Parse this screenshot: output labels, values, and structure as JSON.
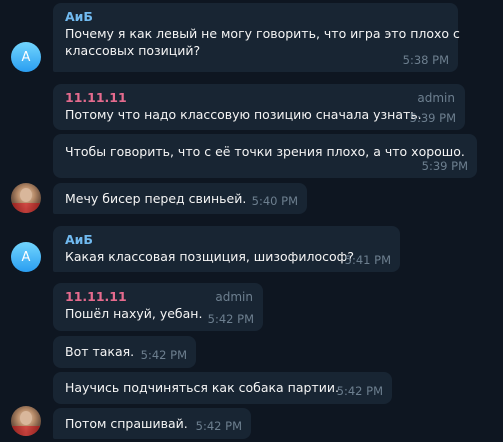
{
  "messages": [
    {
      "sender": "АиБ",
      "lines": [
        "Почему я как левый не могу говорить, что игра это плохо с",
        "классовых позиций?"
      ],
      "time": "5:38 PM"
    },
    {
      "sender": "11.11.11",
      "badge": "admin",
      "lines": [
        "Потому что надо классовую позицию сначала узнать."
      ],
      "time": "5:39 PM"
    },
    {
      "lines": [
        "Чтобы говорить, что с её точки зрения плохо, а что хорошо."
      ],
      "time": "5:39 PM"
    },
    {
      "lines": [
        "Мечу бисер перед свиньей."
      ],
      "time": "5:40 PM"
    },
    {
      "sender": "АиБ",
      "lines": [
        "Какая классовая позщиция, шизофилософ?"
      ],
      "time": "5:41 PM"
    },
    {
      "sender": "11.11.11",
      "badge": "admin",
      "lines": [
        "Пошёл нахуй, уебан."
      ],
      "time": "5:42 PM"
    },
    {
      "lines": [
        "Вот такая."
      ],
      "time": "5:42 PM"
    },
    {
      "lines": [
        "Научись подчиняться как собака партии."
      ],
      "time": "5:42 PM"
    },
    {
      "lines": [
        "Потом спрашивай."
      ],
      "time": "5:42 PM"
    }
  ],
  "avatars": {
    "aib_letter": "A"
  },
  "colors": {
    "background": "#0e1621",
    "bubble": "#182533",
    "sender_aib": "#71baf0",
    "sender_admin": "#e66b8e",
    "meta": "#6d7f8f"
  }
}
